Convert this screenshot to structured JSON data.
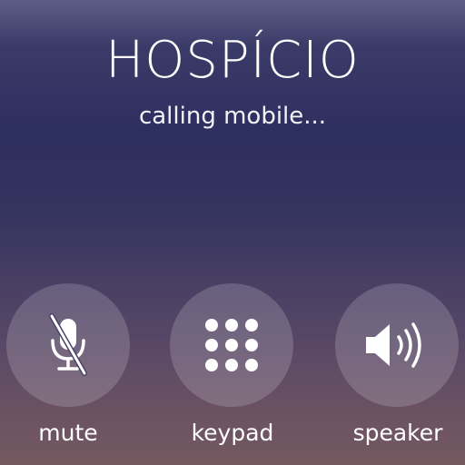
{
  "call": {
    "contact_name": "HOSPÍCIO",
    "status": "calling mobile..."
  },
  "controls": [
    {
      "id": "mute",
      "label": "mute",
      "icon": "microphone-muted-icon"
    },
    {
      "id": "keypad",
      "label": "keypad",
      "icon": "keypad-icon"
    },
    {
      "id": "speaker",
      "label": "speaker",
      "icon": "speaker-icon"
    }
  ]
}
